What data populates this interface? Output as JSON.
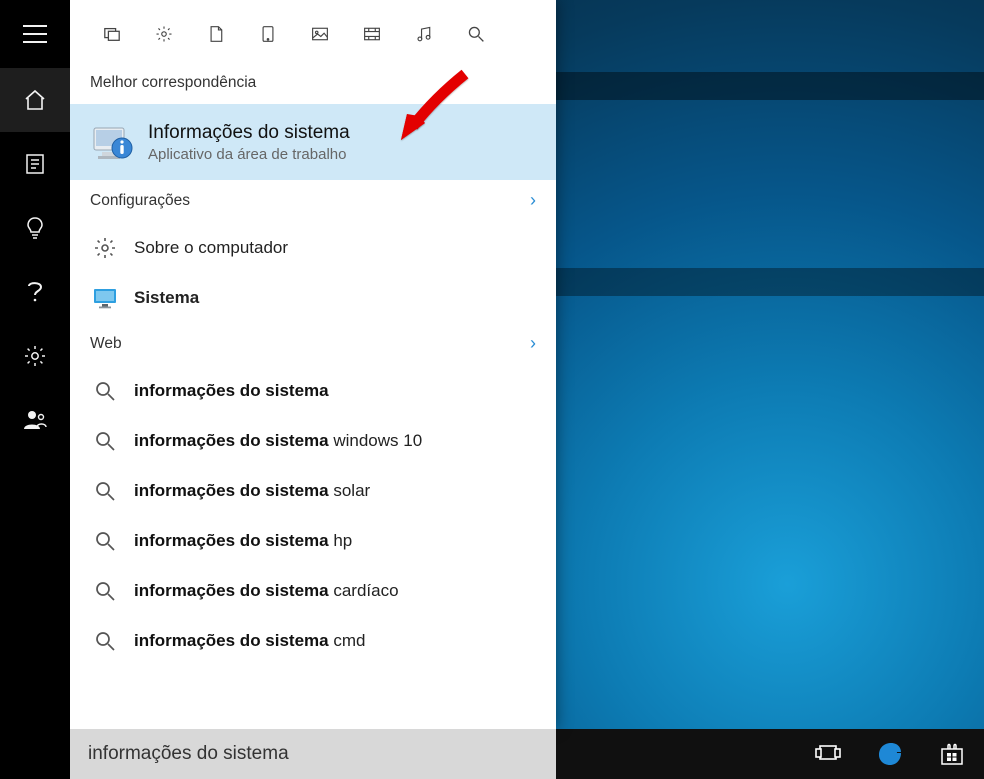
{
  "search_value": "informações do sistema",
  "sections": {
    "best": "Melhor correspondência",
    "settings": "Configurações",
    "web": "Web"
  },
  "best_match": {
    "title": "Informações do sistema",
    "subtitle": "Aplicativo da área de trabalho"
  },
  "settings_results": [
    {
      "label": "Sobre o computador",
      "bold": false,
      "icon": "gear"
    },
    {
      "label": "Sistema",
      "bold": true,
      "icon": "monitor"
    }
  ],
  "web_results": [
    {
      "bold": "informações do sistema",
      "rest": ""
    },
    {
      "bold": "informações do sistema",
      "rest": " windows 10"
    },
    {
      "bold": "informações do sistema",
      "rest": " solar"
    },
    {
      "bold": "informações do sistema",
      "rest": " hp"
    },
    {
      "bold": "informações do sistema",
      "rest": " cardíaco"
    },
    {
      "bold": "informações do sistema",
      "rest": " cmd"
    }
  ],
  "rail": {
    "items": [
      "hamburger",
      "home",
      "notes",
      "tip",
      "help",
      "settings",
      "user"
    ]
  },
  "filter_icons": [
    "apps",
    "settings",
    "document",
    "tablet",
    "photo",
    "video",
    "music",
    "search"
  ],
  "taskbar": {
    "right": [
      "taskview",
      "edge",
      "store"
    ]
  },
  "search_placeholder": ""
}
